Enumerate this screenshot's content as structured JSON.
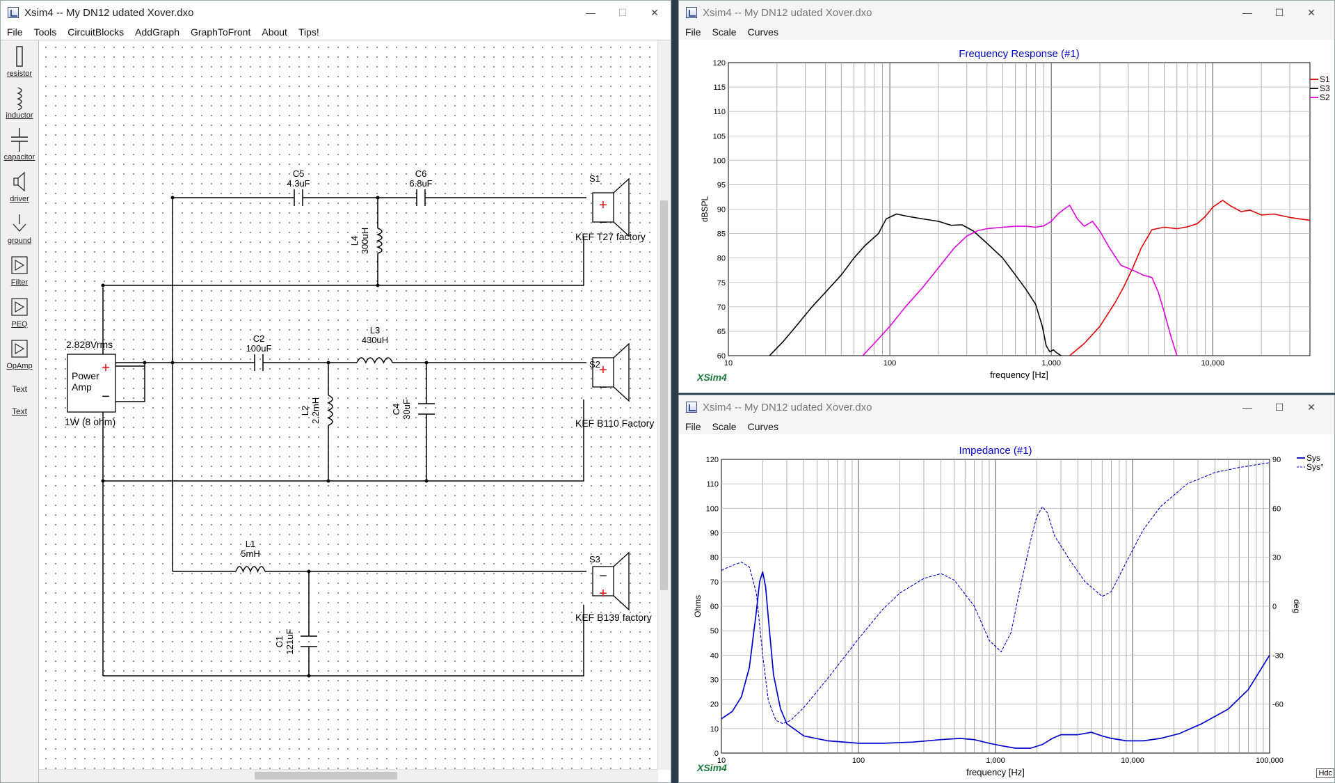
{
  "main_window": {
    "title": "Xsim4 -- My DN12 udated Xover.dxo",
    "menu": [
      "File",
      "Tools",
      "CircuitBlocks",
      "AddGraph",
      "GraphToFront",
      "About",
      "Tips!"
    ],
    "palette": [
      "resistor",
      "inductor",
      "capacitor",
      "driver",
      "ground",
      "Filter",
      "PEQ",
      "OpAmp",
      "Text",
      "Text"
    ]
  },
  "window_controls": {
    "minimize": "—",
    "maximize": "☐",
    "close": "✕"
  },
  "schematic": {
    "amp": {
      "voltage": "2.828Vrms",
      "label1": "Power",
      "label2": "Amp",
      "load": "1W (8 ohm)",
      "plus": "+",
      "minus": "−"
    },
    "components": {
      "C5": {
        "name": "C5",
        "value": "4.3uF"
      },
      "C6": {
        "name": "C6",
        "value": "6.8uF"
      },
      "L4": {
        "name": "L4",
        "value": "300uH"
      },
      "C2": {
        "name": "C2",
        "value": "100uF"
      },
      "L3": {
        "name": "L3",
        "value": "430uH"
      },
      "L2": {
        "name": "L2",
        "value": "2.2mH"
      },
      "C4": {
        "name": "C4",
        "value": "30uF"
      },
      "L1": {
        "name": "L1",
        "value": "5mH"
      },
      "C1": {
        "name": "C1",
        "value": "121uF"
      }
    },
    "drivers": {
      "S1": {
        "name": "S1",
        "desc": "KEF T27 factory",
        "top": "+",
        "bottom": "−"
      },
      "S2": {
        "name": "S2",
        "desc": "KEF B110 Factory",
        "top": "+",
        "bottom": "−"
      },
      "S3": {
        "name": "S3",
        "desc": "KEF B139 factory",
        "top": "−",
        "bottom": "+"
      }
    }
  },
  "freq_window": {
    "title": "Xsim4 -- My DN12 udated Xover.dxo",
    "menu": [
      "File",
      "Scale",
      "Curves"
    ],
    "brand": "XSim4"
  },
  "imp_window": {
    "title": "Xsim4 -- My DN12 udated Xover.dxo",
    "menu": [
      "File",
      "Scale",
      "Curves"
    ],
    "brand": "XSim4",
    "corner_label": "Hdc"
  },
  "chart_data": [
    {
      "type": "line",
      "title": "Frequency Response (#1)",
      "xlabel": "frequency [Hz]",
      "ylabel": "dBSPL",
      "xscale": "log",
      "xlim": [
        10,
        40000
      ],
      "ylim": [
        60,
        120
      ],
      "yticks": [
        60,
        65,
        70,
        75,
        80,
        85,
        90,
        95,
        100,
        105,
        110,
        115,
        120
      ],
      "xtick_labels": [
        {
          "v": 10,
          "t": "10"
        },
        {
          "v": 100,
          "t": "100"
        },
        {
          "v": 1000,
          "t": "1,000"
        },
        {
          "v": 10000,
          "t": "10,000"
        }
      ],
      "grid": true,
      "legend": "right",
      "series": [
        {
          "name": "S1",
          "color": "#e00000",
          "x": [
            1300,
            1600,
            2000,
            2500,
            2800,
            3200,
            3600,
            4200,
            5000,
            6000,
            7000,
            8000,
            9000,
            10000,
            11500,
            13000,
            15000,
            17000,
            20000,
            24000,
            30000,
            40000
          ],
          "y": [
            60,
            62.5,
            66,
            71,
            74,
            78,
            82,
            85.8,
            86.3,
            86,
            86.4,
            87,
            88.5,
            90.4,
            91.8,
            90.6,
            89.5,
            89.8,
            88.8,
            89,
            88.3,
            87.7
          ]
        },
        {
          "name": "S3",
          "color": "#000000",
          "x": [
            18,
            22,
            27,
            33,
            40,
            50,
            60,
            70,
            85,
            95,
            110,
            130,
            160,
            200,
            240,
            280,
            330,
            400,
            500,
            600,
            700,
            800,
            880,
            930,
            980,
            1030,
            1080,
            1150
          ],
          "y": [
            60,
            63,
            66.5,
            70,
            73,
            76.5,
            80,
            82.5,
            85,
            88,
            89,
            88.5,
            88,
            87.5,
            86.7,
            86.8,
            85.5,
            83,
            80,
            76.5,
            73.5,
            70.5,
            66,
            62,
            60.8,
            61.2,
            60.6,
            60
          ]
        },
        {
          "name": "S2",
          "color": "#e000e0",
          "x": [
            68,
            80,
            100,
            125,
            160,
            200,
            250,
            300,
            350,
            400,
            500,
            600,
            700,
            800,
            900,
            1000,
            1100,
            1200,
            1300,
            1450,
            1600,
            1800,
            2000,
            2300,
            2700,
            3200,
            3700,
            4200,
            4600,
            5000,
            5500,
            6000
          ],
          "y": [
            60,
            62.5,
            66,
            70,
            74,
            78,
            82,
            84.5,
            85.6,
            86,
            86.3,
            86.5,
            86.5,
            86.3,
            86.6,
            87.5,
            89,
            90,
            90.8,
            88,
            86.5,
            87.5,
            85.5,
            82,
            78.5,
            77.5,
            76.5,
            76,
            73,
            69,
            64,
            60
          ]
        }
      ]
    },
    {
      "type": "line",
      "title": "Impedance (#1)",
      "xlabel": "frequency [Hz]",
      "ylabel": "Ohms",
      "y2label": "deg",
      "xscale": "log",
      "xlim": [
        10,
        100000
      ],
      "ylim": [
        0,
        120
      ],
      "y2lim": [
        -90,
        90
      ],
      "yticks": [
        0,
        10,
        20,
        30,
        40,
        50,
        60,
        70,
        80,
        90,
        100,
        110,
        120
      ],
      "y2ticks": [
        -60,
        -30,
        0,
        30,
        60,
        90
      ],
      "xtick_labels": [
        {
          "v": 10,
          "t": "10"
        },
        {
          "v": 100,
          "t": "100"
        },
        {
          "v": 1000,
          "t": "1,000"
        },
        {
          "v": 10000,
          "t": "10,000"
        },
        {
          "v": 100000,
          "t": "100,000"
        }
      ],
      "grid": true,
      "legend": "top-right",
      "series": [
        {
          "name": "Sys",
          "color": "#0000cc",
          "style": "solid",
          "axis": "left",
          "x": [
            10,
            12,
            14,
            16,
            18,
            19,
            20,
            21,
            22,
            24,
            27,
            30,
            40,
            60,
            100,
            150,
            250,
            400,
            550,
            700,
            900,
            1100,
            1400,
            1800,
            2200,
            2600,
            3000,
            4000,
            5000,
            6000,
            7000,
            9000,
            12000,
            16000,
            22000,
            32000,
            50000,
            70000,
            100000
          ],
          "y": [
            14,
            17,
            23,
            35,
            58,
            70,
            74,
            68,
            55,
            32,
            18,
            12,
            7,
            5,
            4,
            4,
            4.5,
            5.5,
            6,
            5.5,
            4,
            3,
            2,
            2,
            3.5,
            6,
            7.5,
            7.5,
            8.5,
            7,
            6,
            5,
            5,
            6,
            8,
            12,
            18,
            26,
            40
          ]
        },
        {
          "name": "Sys°",
          "color": "#0000cc",
          "style": "dashed",
          "axis": "right",
          "x": [
            10,
            12,
            14,
            16,
            18,
            20,
            22,
            25,
            28,
            32,
            40,
            60,
            100,
            150,
            200,
            300,
            400,
            500,
            700,
            900,
            1100,
            1300,
            1500,
            1800,
            2000,
            2200,
            2400,
            2700,
            3000,
            3500,
            4500,
            6000,
            7000,
            9000,
            12000,
            16000,
            25000,
            40000,
            60000,
            100000
          ],
          "y": [
            22,
            25,
            27,
            24,
            8,
            -30,
            -58,
            -70,
            -72,
            -70,
            -62,
            -44,
            -20,
            -2,
            8,
            17,
            20,
            16,
            0,
            -21,
            -28,
            -16,
            10,
            40,
            55,
            61,
            57,
            43,
            37,
            28,
            15,
            6,
            9,
            27,
            47,
            61,
            75,
            82,
            85,
            88
          ]
        }
      ]
    }
  ]
}
